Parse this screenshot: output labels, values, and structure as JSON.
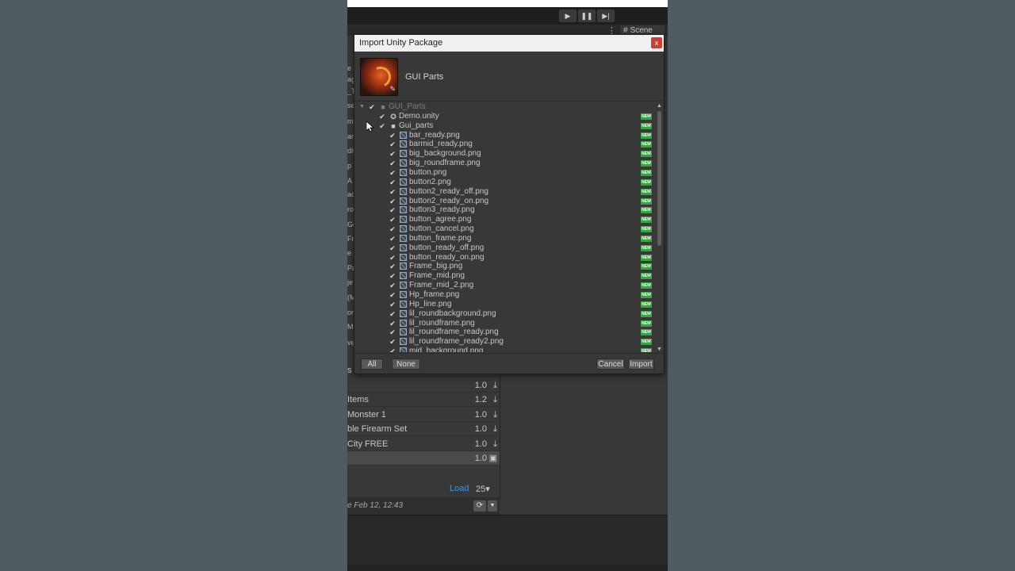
{
  "editor": {
    "scene_tab": "Scene",
    "scene_icon": "grid-icon",
    "play_icons": [
      "play-icon",
      "pause-icon",
      "step-icon"
    ],
    "left_fragments": [
      "e M",
      "ag",
      "_Ti",
      "se",
      "me",
      "ar",
      "dit",
      "p",
      "A",
      "ac",
      "roi",
      "Go",
      "Fr",
      "e I",
      "Pa",
      "je",
      "(M",
      "on",
      "M",
      "ve"
    ]
  },
  "dialog": {
    "title": "Import Unity Package",
    "close_label": "x",
    "package_name": "GUI Parts",
    "new_badge": "NEW",
    "root": "GUI_Parts",
    "items": [
      {
        "name": "Demo.unity",
        "indent": 1,
        "icon": "unity-icon"
      },
      {
        "name": "Gui_parts",
        "indent": 1,
        "icon": "folder-icon"
      },
      {
        "name": "bar_ready.png",
        "indent": 2,
        "icon": "image-icon"
      },
      {
        "name": "barmid_ready.png",
        "indent": 2,
        "icon": "image-icon"
      },
      {
        "name": "big_background.png",
        "indent": 2,
        "icon": "image-icon"
      },
      {
        "name": "big_roundframe.png",
        "indent": 2,
        "icon": "image-icon"
      },
      {
        "name": "button.png",
        "indent": 2,
        "icon": "image-icon"
      },
      {
        "name": "button2.png",
        "indent": 2,
        "icon": "image-icon"
      },
      {
        "name": "button2_ready_off.png",
        "indent": 2,
        "icon": "image-icon"
      },
      {
        "name": "button2_ready_on.png",
        "indent": 2,
        "icon": "image-icon"
      },
      {
        "name": "button3_ready.png",
        "indent": 2,
        "icon": "image-icon"
      },
      {
        "name": "button_agree.png",
        "indent": 2,
        "icon": "image-icon"
      },
      {
        "name": "button_cancel.png",
        "indent": 2,
        "icon": "image-icon"
      },
      {
        "name": "button_frame.png",
        "indent": 2,
        "icon": "image-icon"
      },
      {
        "name": "button_ready_off.png",
        "indent": 2,
        "icon": "image-icon"
      },
      {
        "name": "button_ready_on.png",
        "indent": 2,
        "icon": "image-icon"
      },
      {
        "name": "Frame_big.png",
        "indent": 2,
        "icon": "image-icon"
      },
      {
        "name": "Frame_mid.png",
        "indent": 2,
        "icon": "image-icon"
      },
      {
        "name": "Frame_mid_2.png",
        "indent": 2,
        "icon": "image-icon"
      },
      {
        "name": "Hp_frame.png",
        "indent": 2,
        "icon": "image-icon"
      },
      {
        "name": "Hp_line.png",
        "indent": 2,
        "icon": "image-icon"
      },
      {
        "name": "lil_roundbackground.png",
        "indent": 2,
        "icon": "image-icon"
      },
      {
        "name": "lil_roundframe.png",
        "indent": 2,
        "icon": "image-icon"
      },
      {
        "name": "lil_roundframe_ready.png",
        "indent": 2,
        "icon": "image-icon"
      },
      {
        "name": "lil_roundframe_ready2.png",
        "indent": 2,
        "icon": "image-icon"
      },
      {
        "name": "mid_background.png",
        "indent": 2,
        "icon": "image-icon"
      }
    ],
    "buttons": {
      "all": "All",
      "none": "None",
      "cancel": "Cancel",
      "import": "Import"
    }
  },
  "package_manager": {
    "rows": [
      {
        "name": "s",
        "version": "1.0",
        "action": "download-icon"
      },
      {
        "name": "",
        "version": "1.0",
        "action": "download-icon"
      },
      {
        "name": "Items",
        "version": "1.2",
        "action": "download-icon"
      },
      {
        "name": "Monster 1",
        "version": "1.0",
        "action": "download-icon"
      },
      {
        "name": "ble Firearm Set",
        "version": "1.0",
        "action": "download-icon"
      },
      {
        "name": "City FREE",
        "version": "1.0",
        "action": "download-icon"
      },
      {
        "name": "",
        "version": "1.0",
        "action": "import-icon"
      }
    ],
    "load_label": "Load",
    "per_page": "25▾",
    "updated": "e Feb 12, 12:43"
  }
}
